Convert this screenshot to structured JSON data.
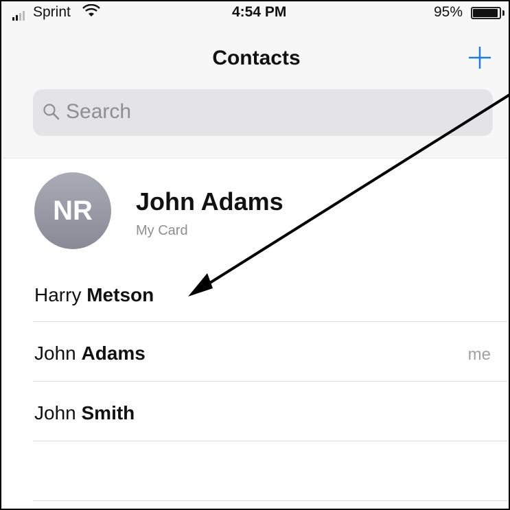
{
  "status_bar": {
    "carrier": "Sprint",
    "time": "4:54 PM",
    "battery_percent": "95%",
    "battery_level": 0.95
  },
  "nav": {
    "title": "Contacts",
    "add_icon": "plus-icon"
  },
  "search": {
    "placeholder": "Search",
    "icon": "search-icon"
  },
  "my_card": {
    "initials": "NR",
    "name": "John Adams",
    "subtitle": "My Card"
  },
  "contacts": [
    {
      "first": "Harry",
      "last": "Metson",
      "meta": ""
    },
    {
      "first": "John",
      "last": "Adams",
      "meta": "me"
    },
    {
      "first": "John",
      "last": "Smith",
      "meta": ""
    }
  ],
  "colors": {
    "accent": "#1a7cf5",
    "avatar_bg": "#9a9da8",
    "separator": "#dcdcdc"
  }
}
